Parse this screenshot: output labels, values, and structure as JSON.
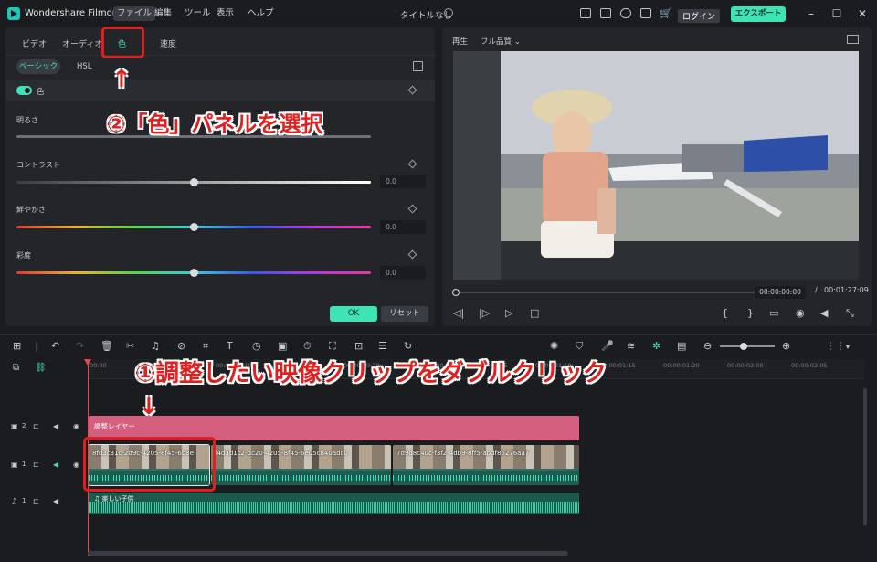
{
  "app": {
    "name": "Wondershare Filmora",
    "doc_title": "タイトルなし",
    "login": "ログイン",
    "export": "エクスポート"
  },
  "menu": [
    "ファイル",
    "編集",
    "ツール",
    "表示",
    "ヘルプ"
  ],
  "panel": {
    "tabs": [
      "ビデオ",
      "オーディオ",
      "色",
      "速度"
    ],
    "subtabs": [
      "ベーシック",
      "HSL"
    ],
    "section": "色",
    "params": [
      {
        "label": "明るさ",
        "value": "",
        "pos": 0.5
      },
      {
        "label": "コントラスト",
        "value": "0.0",
        "pos": 0.5
      },
      {
        "label": "鮮やかさ",
        "value": "0.0",
        "pos": 0.5
      },
      {
        "label": "彩度",
        "value": "0.0",
        "pos": 0.5
      }
    ],
    "ok": "OK",
    "reset": "リセット"
  },
  "preview": {
    "play_label": "再生",
    "quality": "フル品質",
    "current_time": "00:00:00:00",
    "separator": "/",
    "total_time": "00:01:27:09"
  },
  "timeline": {
    "ruler": [
      "00:00",
      "00:00:00:05",
      "00:00:00:10",
      "00:00:00:15",
      "00:00:00:20",
      "00:00:01:00",
      "00:00:01:05",
      "00:00:01:10",
      "00:00:01:15",
      "00:00:01:20",
      "00:00:02:00",
      "00:00:02:05"
    ],
    "tracks": [
      {
        "label": "2"
      },
      {
        "label": "1"
      },
      {
        "label": "1"
      }
    ],
    "adjustment_clip": "調整レイヤー",
    "video_clips": [
      "8fd3c31c-2d9c-4205-8f45-6b8e",
      "f4d3d1c2-dc20-4205-8f45-6e05c840adc0",
      "7d9d8c40c-f3f2-4db9-8ff5-abdf86276aa7"
    ],
    "audio_clip": "楽しい子供"
  },
  "annotations": {
    "step1": "①調整したい映像クリップをダブルクリック",
    "step2": "②「色」パネルを選択",
    "arrow_up": "↑",
    "arrow_down": "↓"
  },
  "colors": {
    "accent": "#3ee3b6",
    "highlight": "#e01f1f",
    "adjustment": "#d55f7e"
  }
}
